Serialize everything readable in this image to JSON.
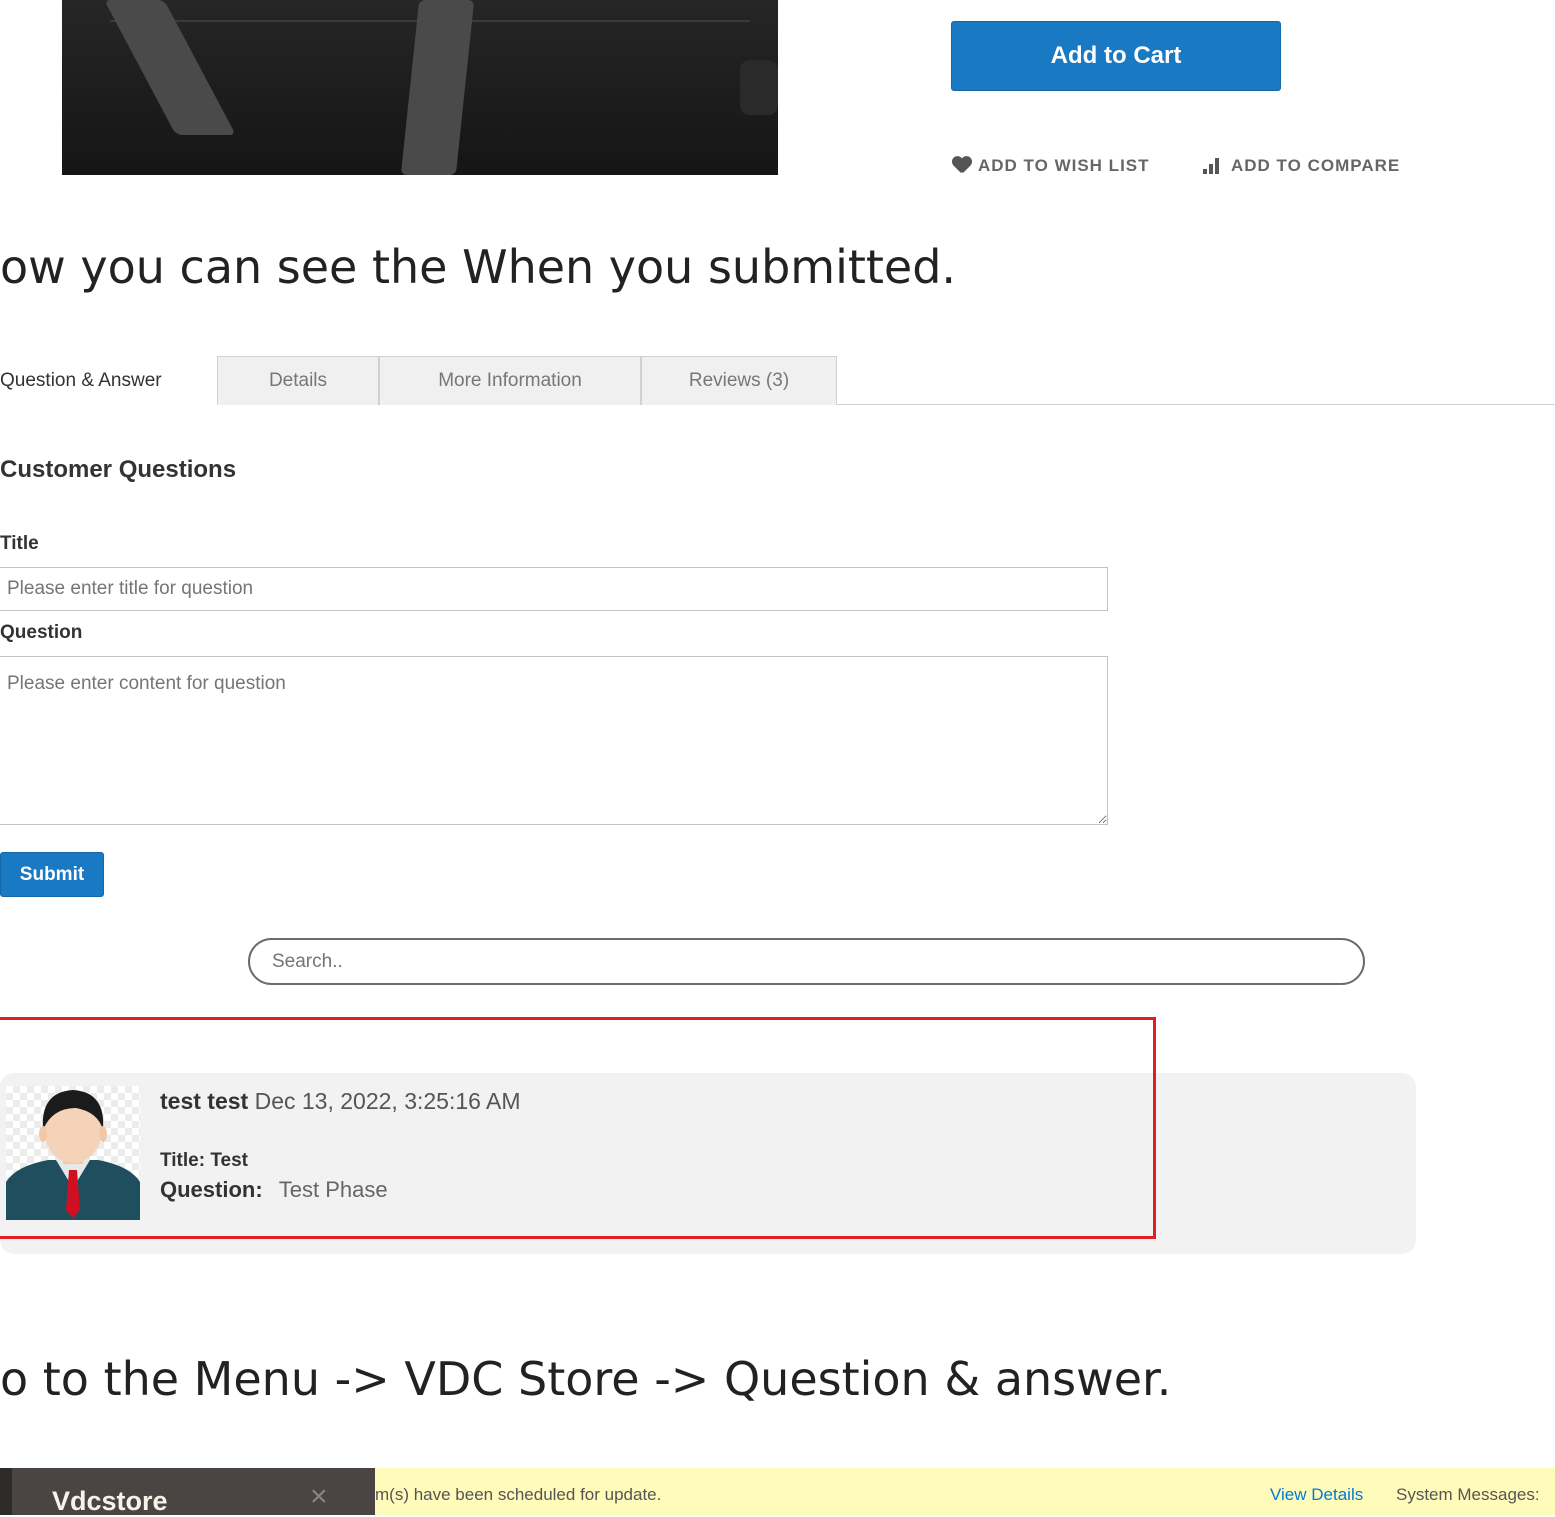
{
  "product": {
    "add_to_cart": "Add to Cart",
    "wish_list": "ADD TO WISH LIST",
    "compare": "ADD TO COMPARE"
  },
  "tutorial": {
    "step_submitted": "ow you can see the When you submitted.",
    "step_menu": "o to the Menu -> VDC Store -> Question & answer."
  },
  "tabs": [
    {
      "label": "Question & Answer",
      "active": true
    },
    {
      "label": "Details"
    },
    {
      "label": "More Information"
    },
    {
      "label": "Reviews (3)"
    }
  ],
  "qa_form": {
    "heading": "Customer Questions",
    "title_label": "Title",
    "title_placeholder": "Please enter title for question",
    "question_label": "Question",
    "question_placeholder": "Please enter content for question",
    "submit": "Submit"
  },
  "search": {
    "placeholder": "Search.."
  },
  "question_item": {
    "author": "test test",
    "date": "Dec 13, 2022, 3:25:16 AM",
    "title_label": "Title:",
    "title_value": "Test",
    "question_label": "Question:",
    "question_value": "Test Phase"
  },
  "admin": {
    "store_title": "Vdcstore",
    "close_glyph": "×",
    "message": "m(s) have been scheduled for update.",
    "view_details": "View Details",
    "system_messages": "System Messages:"
  },
  "colors": {
    "primary": "#1979c3",
    "highlight": "#e02020",
    "admin_bar": "#fffbbb"
  }
}
